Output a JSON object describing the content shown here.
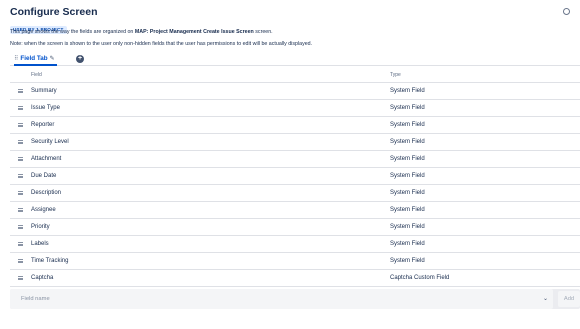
{
  "page": {
    "title": "Configure Screen",
    "badge": "USED BY 1 PROJECT",
    "desc1_prefix": "This page shows the way the fields are organized on ",
    "desc1_bold": "MAP: Project Management Create Issue Screen",
    "desc1_suffix": " screen.",
    "desc2": "Note: when the screen is shown to the user only non-hidden fields that the user has permissions to edit will be actually displayed."
  },
  "tabs": {
    "active_label": "Field Tab",
    "add_symbol": "+"
  },
  "table": {
    "headers": {
      "field": "Field",
      "type": "Type"
    },
    "rows": [
      {
        "name": "Summary",
        "type": "System Field"
      },
      {
        "name": "Issue Type",
        "type": "System Field"
      },
      {
        "name": "Reporter",
        "type": "System Field"
      },
      {
        "name": "Security Level",
        "type": "System Field"
      },
      {
        "name": "Attachment",
        "type": "System Field"
      },
      {
        "name": "Due Date",
        "type": "System Field"
      },
      {
        "name": "Description",
        "type": "System Field"
      },
      {
        "name": "Assignee",
        "type": "System Field"
      },
      {
        "name": "Priority",
        "type": "System Field"
      },
      {
        "name": "Labels",
        "type": "System Field"
      },
      {
        "name": "Time Tracking",
        "type": "System Field"
      },
      {
        "name": "Captcha",
        "type": "Captcha Custom Field"
      }
    ]
  },
  "add_field": {
    "placeholder": "Field name",
    "add_label": "Add"
  }
}
